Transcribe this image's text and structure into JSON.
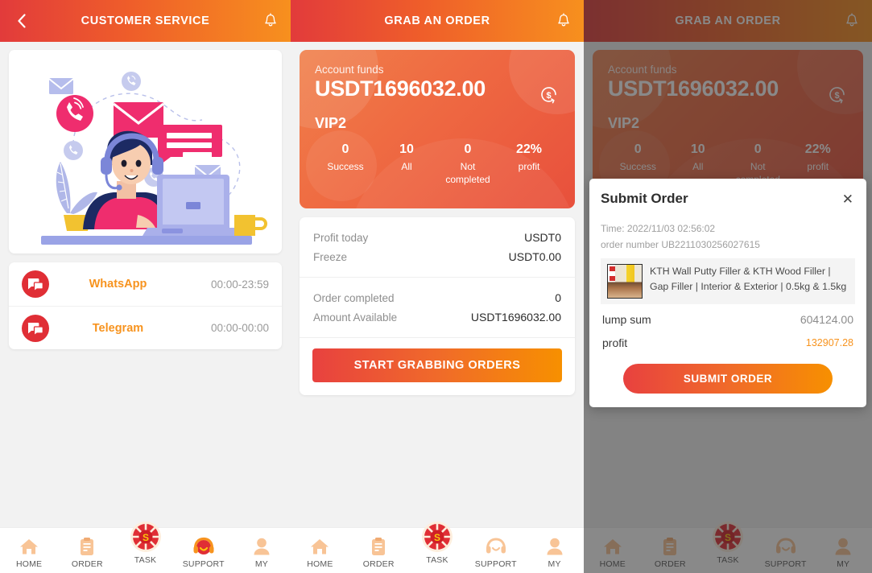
{
  "screens": [
    {
      "header": {
        "back_icon": "chevron-left-icon",
        "title": "CUSTOMER SERVICE",
        "bell_icon": "bell-icon"
      },
      "illustration": "customer-service-illustration",
      "contacts": [
        {
          "icon": "chat-bubble-icon",
          "name": "WhatsApp",
          "hours": "00:00-23:59"
        },
        {
          "icon": "chat-bubble-icon",
          "name": "Telegram",
          "hours": "00:00-00:00"
        }
      ]
    },
    {
      "header": {
        "title": "GRAB AN ORDER",
        "bell_icon": "bell-icon"
      },
      "funds": {
        "label": "Account funds",
        "amount": "USDT1696032.00",
        "vip": "VIP2",
        "refund_icon": "money-refresh-icon",
        "stats": [
          {
            "value": "0",
            "label": "Success"
          },
          {
            "value": "10",
            "label": "All"
          },
          {
            "value": "0",
            "label": "Not completed"
          },
          {
            "value": "22%",
            "label": "profit"
          }
        ]
      },
      "summary": {
        "group1": [
          {
            "key": "Profit today",
            "value": "USDT0"
          },
          {
            "key": "Freeze",
            "value": "USDT0.00"
          }
        ],
        "group2": [
          {
            "key": "Order completed",
            "value": "0"
          },
          {
            "key": "Amount Available",
            "value": "USDT1696032.00"
          }
        ],
        "cta": "START GRABBING ORDERS"
      }
    },
    {
      "header": {
        "title": "GRAB AN ORDER",
        "bell_icon": "bell-icon"
      },
      "modal": {
        "title": "Submit Order",
        "close_icon": "close-icon",
        "time": "Time:  2022/11/03 02:56:02",
        "order_number": "order number UB2211030256027615",
        "product": {
          "thumb": "product-thumbnail",
          "name": "KTH Wall Putty Filler & KTH Wood Filler | Gap Filler | Interior & Exterior | 0.5kg & 1.5kg"
        },
        "rows": [
          {
            "key": "lump sum",
            "value": "604124.00",
            "accent": false
          },
          {
            "key": "profit",
            "value": "132907.28",
            "accent": true
          }
        ],
        "cta": "SUBMIT ORDER"
      }
    }
  ],
  "nav": {
    "items": [
      {
        "icon": "home-icon",
        "label": "HOME"
      },
      {
        "icon": "clipboard-icon",
        "label": "ORDER"
      },
      {
        "icon": "task-wheel-icon",
        "label": "TASK"
      },
      {
        "icon": "headset-icon",
        "label": "SUPPORT"
      },
      {
        "icon": "person-icon",
        "label": "MY"
      }
    ]
  },
  "colors": {
    "brand_red": "#e23b3b",
    "brand_orange": "#f7931e",
    "accent_profit": "#f7931e",
    "nav_icon": "#f8c496",
    "nav_active": "#e8413f"
  }
}
